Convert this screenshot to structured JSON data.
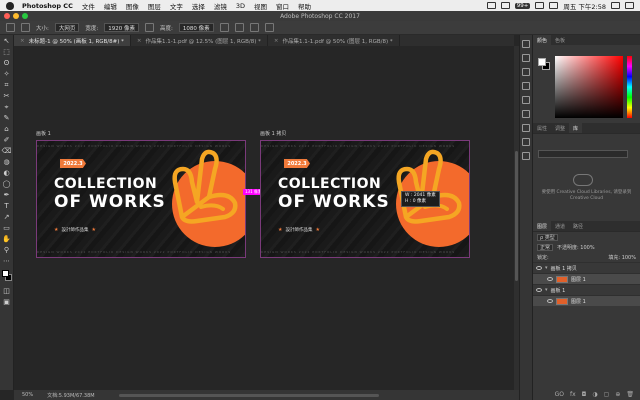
{
  "menubar": {
    "app": "Photoshop CC",
    "items": [
      "文件",
      "编辑",
      "图像",
      "图层",
      "文字",
      "选择",
      "滤镜",
      "3D",
      "视图",
      "窗口",
      "帮助"
    ],
    "badge": "99+",
    "clock": "周五 下午2:58"
  },
  "window": {
    "title": "Adobe Photoshop CC 2017",
    "traffic_colors": [
      "#ff5f57",
      "#febc2e",
      "#28c840"
    ]
  },
  "options": {
    "size_label": "大小:",
    "size_value": "大网页",
    "width_label": "宽度:",
    "width_value": "1920 像素",
    "height_label": "高度:",
    "height_value": "1080 像素"
  },
  "tabs": [
    {
      "label": "未标题-1 @ 50% (画板 1, RGB/8#) *",
      "active": true
    },
    {
      "label": "作品集1.1-1.pdf @ 12.5% (图层 1, RGB/8) *",
      "active": false
    },
    {
      "label": "作品集1.1-1.pdf @ 50% (图层 1, RGB/8) *",
      "active": false
    }
  ],
  "tools": [
    "↖",
    "⬚",
    "ʘ",
    "✧",
    "⌗",
    "✂",
    "⌖",
    "✎",
    "⌂",
    "✐",
    "⌫",
    "◍",
    "◐",
    "◯",
    "✒",
    "T",
    "↗",
    "▭",
    "✋",
    "⚲",
    "⋯"
  ],
  "artboards": [
    {
      "label": "画板 1",
      "year": "2022.3",
      "title1": "COLLECTION",
      "title2": "OF WORKS",
      "sub": "設計師作品集",
      "strip": "DESIGN WORKS  2022  PORTFOLIO  DESIGN WORKS  2022  PORTFOLIO  DESIGN WORKS"
    },
    {
      "label": "画板 1 拷贝",
      "year": "2022.3",
      "title1": "COLLECTION",
      "title2": "OF WORKS",
      "sub": "設計師作品集",
      "strip": "DESIGN WORKS  2022  PORTFOLIO  DESIGN WORKS  2022  PORTFOLIO  DESIGN WORKS"
    }
  ],
  "measure": "131 像素",
  "tooltip": {
    "w": "W : 2041 像素",
    "h": "H :   0 像素"
  },
  "status": {
    "zoom": "50%",
    "doc": "文档:5.93M/67.38M"
  },
  "panels": {
    "color_tabs": [
      "颜色",
      "色板"
    ],
    "fg_color": "#ffffff",
    "bg_color": "#000000",
    "library_tabs": [
      "属性",
      "调整",
      "库"
    ],
    "cc_text": "要使用 Creative Cloud Libraries, 请登录到 Creative Cloud",
    "layer_tabs": [
      "图层",
      "通道",
      "路径"
    ],
    "kind_label": "ρ 类型",
    "blend_mode": "正常",
    "opacity": "不透明度: 100%",
    "lock_label": "锁定:",
    "fill": "填充: 100%",
    "layers": [
      {
        "name": "画板 1 拷贝",
        "type": "group",
        "selected": false
      },
      {
        "name": "图层 1",
        "type": "layer",
        "selected": true
      },
      {
        "name": "画板 1",
        "type": "group",
        "selected": false
      },
      {
        "name": "图层 1",
        "type": "layer",
        "selected": true
      }
    ],
    "footer_icons": [
      "GO",
      "fx",
      "◘",
      "◑",
      "▢",
      "⊕",
      "🗑"
    ]
  }
}
